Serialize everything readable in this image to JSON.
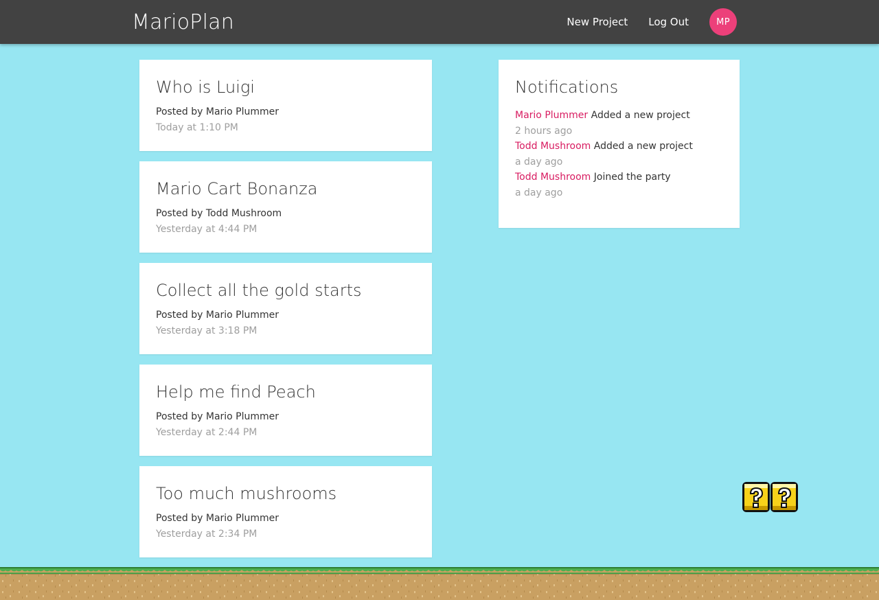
{
  "navbar": {
    "brand": "MarioPlan",
    "links": [
      "New Project",
      "Log Out"
    ],
    "avatar_initials": "MP",
    "colors": {
      "background": "#424242",
      "avatar": "#ec407a"
    }
  },
  "projects": [
    {
      "title": "Who is Luigi",
      "author": "Posted by Mario Plummer",
      "date": "Today at 1:10 PM"
    },
    {
      "title": "Mario Cart Bonanza",
      "author": "Posted by Todd Mushroom",
      "date": "Yesterday at 4:44 PM"
    },
    {
      "title": "Collect all the gold starts",
      "author": "Posted by Mario Plummer",
      "date": "Yesterday at 3:18 PM"
    },
    {
      "title": "Help me find Peach",
      "author": "Posted by Mario Plummer",
      "date": "Yesterday at 2:44 PM"
    },
    {
      "title": "Too much mushrooms",
      "author": "Posted by Mario Plummer",
      "date": "Yesterday at 2:34 PM"
    }
  ],
  "notifications": {
    "title": "Notifications",
    "items": [
      {
        "user": "Mario Plummer",
        "content": "Added a new project",
        "time": "2 hours ago"
      },
      {
        "user": "Todd Mushroom",
        "content": "Added a new project",
        "time": "a day ago"
      },
      {
        "user": "Todd Mushroom",
        "content": "Joined the party",
        "time": "a day ago"
      }
    ],
    "colors": {
      "user": "#d81b60",
      "time": "#9e9e9e"
    }
  },
  "decor": {
    "question_block_icon": "question-block-icon",
    "ground_icon": "grass-ground",
    "colors": {
      "sky": "#97e6f2",
      "grass": "#4caf50",
      "dirt": "#c9a062"
    }
  }
}
